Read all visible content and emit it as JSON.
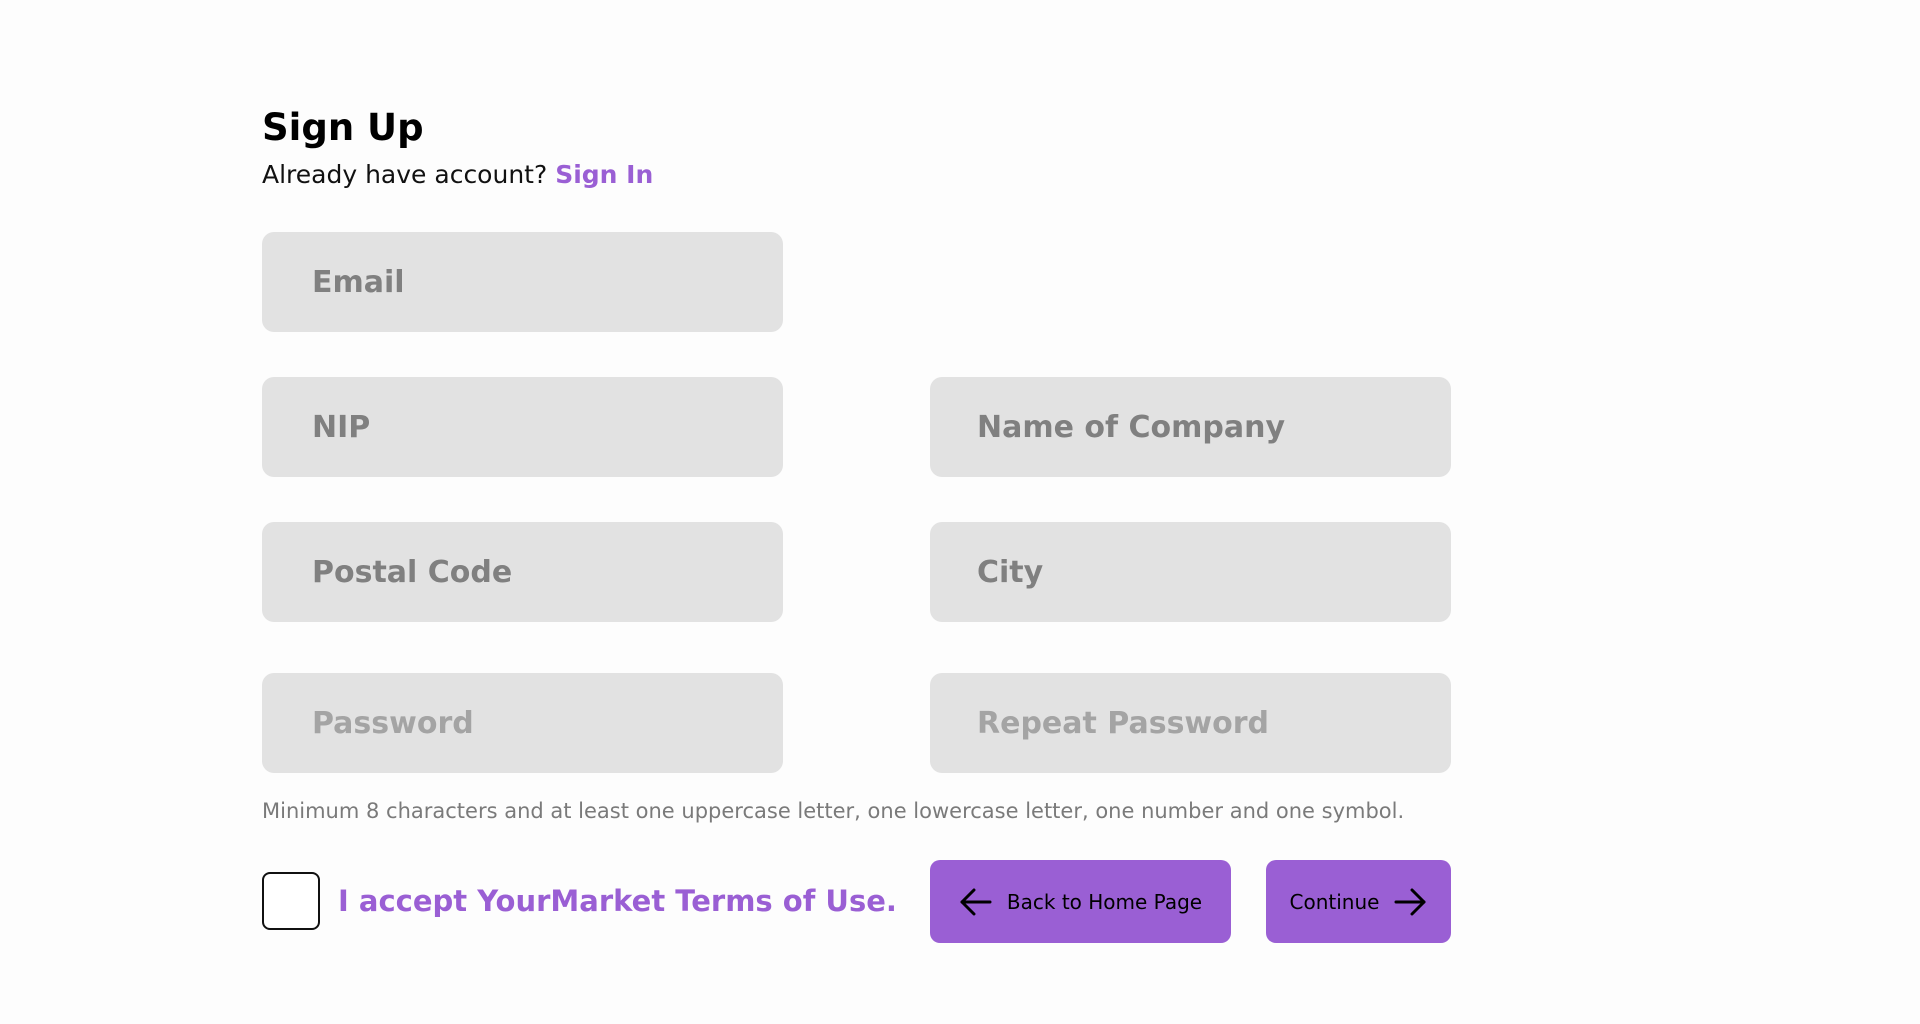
{
  "header": {
    "title": "Sign Up",
    "subtitle_text": "Already have account?",
    "signin_link": "Sign In"
  },
  "form": {
    "email_placeholder": "Email",
    "nip_placeholder": "NIP",
    "company_placeholder": "Name of Company",
    "postal_placeholder": "Postal Code",
    "city_placeholder": "City",
    "password_placeholder": "Password",
    "repeat_password_placeholder": "Repeat Password",
    "password_hint": "Minimum 8 characters and at least one uppercase letter, one lowercase letter, one number and one symbol."
  },
  "terms": {
    "label": "I accept YourMarket Terms of Use.",
    "checked": false
  },
  "actions": {
    "back_label": "Back to Home Page",
    "back_icon": "arrow-left-icon",
    "continue_label": "Continue",
    "continue_icon": "arrow-right-icon"
  },
  "colors": {
    "accent": "#9a5fd4",
    "field_bg": "#e2e2e2",
    "placeholder": "#808080",
    "hint": "#7a7a7a"
  }
}
